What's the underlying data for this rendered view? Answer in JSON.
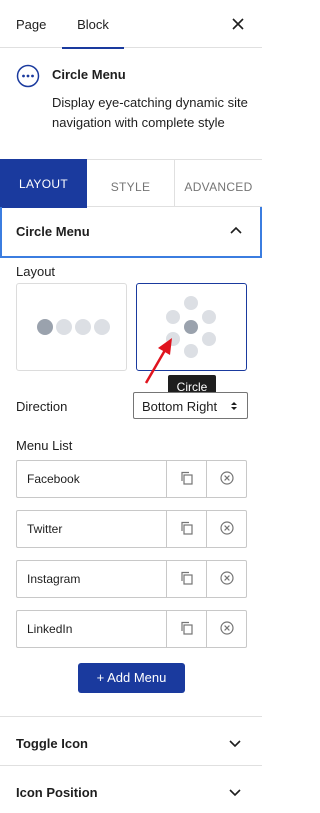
{
  "header": {
    "tabs": [
      "Page",
      "Block"
    ],
    "active_tab": "Block",
    "close_icon": "close-icon"
  },
  "block": {
    "icon": "ellipsis-circle-icon",
    "title": "Circle Menu",
    "description": "Display eye-catching dynamic site navigation with complete style"
  },
  "style_tabs": {
    "items": [
      "LAYOUT",
      "STYLE",
      "ADVANCED"
    ],
    "active": "LAYOUT"
  },
  "panel": {
    "title": "Circle Menu",
    "expanded": true,
    "layout_label": "Layout",
    "layout_options": [
      "horizontal",
      "circle"
    ],
    "selected_layout": "circle",
    "tooltip": "Circle",
    "direction_label": "Direction",
    "direction_value": "Bottom Right",
    "menu_list_label": "Menu List",
    "menu_items": [
      "Facebook",
      "Twitter",
      "Instagram",
      "LinkedIn"
    ],
    "add_menu_label": "+ Add Menu"
  },
  "sections": {
    "toggle_icon": "Toggle Icon",
    "icon_position": "Icon Position"
  },
  "colors": {
    "accent": "#1a3a9e",
    "focus_border": "#3b7de0",
    "annotation_arrow": "#e0141e"
  }
}
